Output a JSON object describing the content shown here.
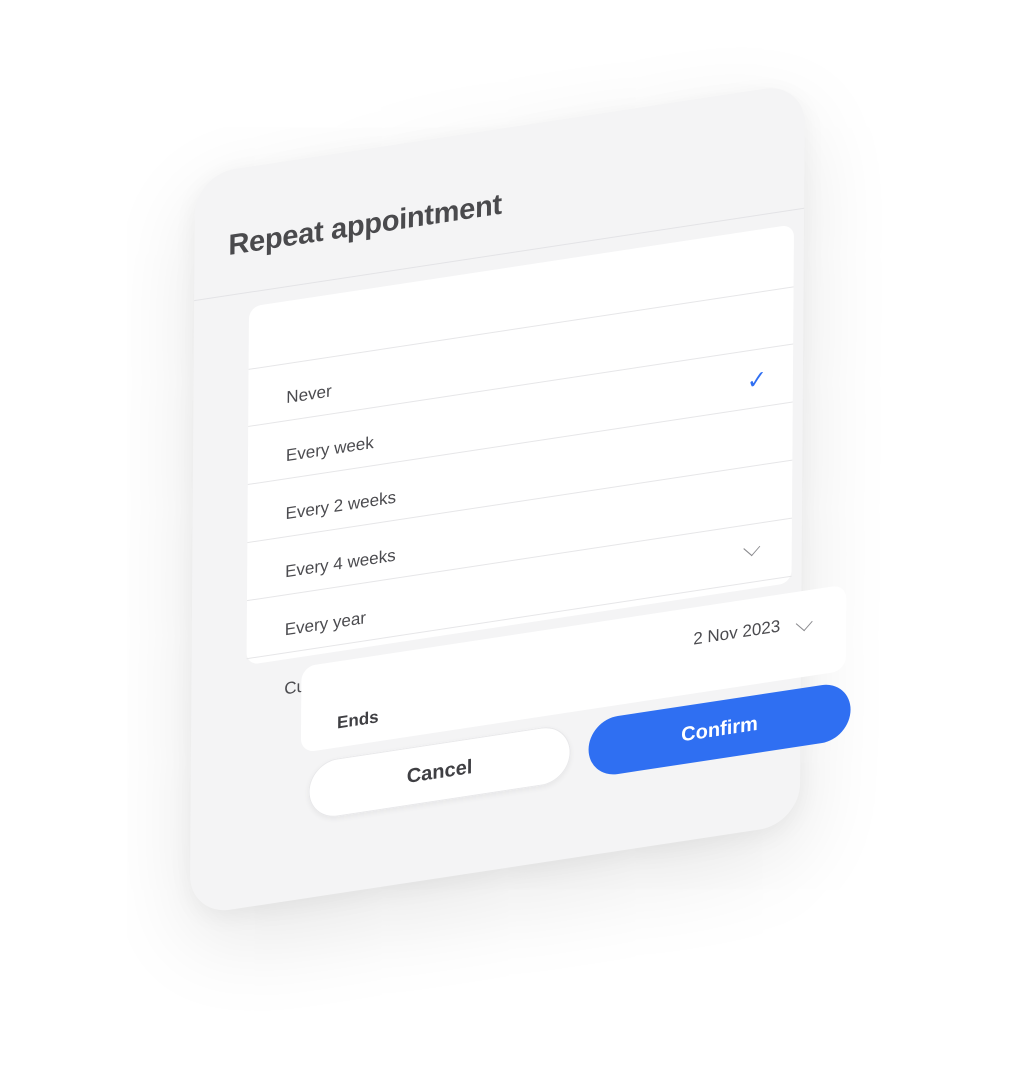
{
  "modal": {
    "title": "Repeat appointment"
  },
  "repeat_options": {
    "items": [
      {
        "label": "Never"
      },
      {
        "label": "Every week"
      },
      {
        "label": "Every 2 weeks"
      },
      {
        "label": "Every 4 weeks"
      },
      {
        "label": "Every year"
      },
      {
        "label": "Custom"
      }
    ],
    "selected_label": "Every week",
    "check_icon": "checkmark-icon",
    "expand_icon": "chevron-down-icon"
  },
  "ends": {
    "label": "Ends",
    "value": "2 Nov 2023",
    "icon": "chevron-down-icon"
  },
  "actions": {
    "cancel_label": "Cancel",
    "confirm_label": "Confirm"
  },
  "colors": {
    "accent": "#2f6ff2",
    "sheet_background": "#f4f4f5",
    "card_background": "#ffffff",
    "text_primary": "#4a4a4d"
  }
}
